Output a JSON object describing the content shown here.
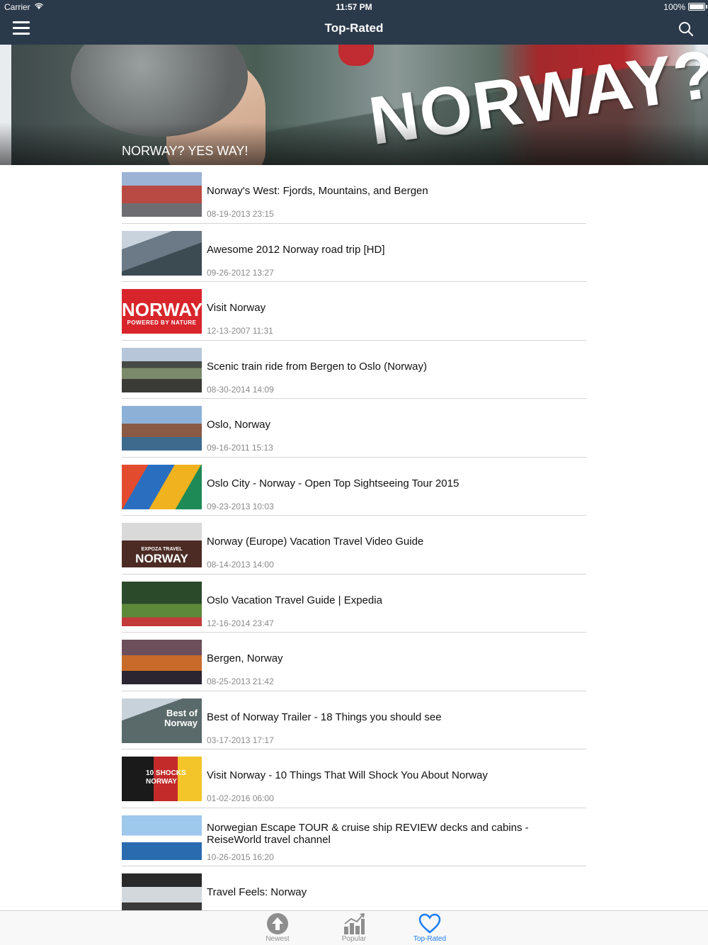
{
  "status_bar": {
    "carrier": "Carrier",
    "time": "11:57 PM",
    "battery": "100%"
  },
  "nav": {
    "title": "Top-Rated",
    "menu_icon": "hamburger-menu-icon",
    "search_icon": "search-icon"
  },
  "hero": {
    "caption": "NORWAY? YES WAY!",
    "image_text": "NORWAY?"
  },
  "videos": [
    {
      "title": "Norway's West: Fjords, Mountains, and Bergen",
      "date": "08-19-2013 23:15"
    },
    {
      "title": "Awesome 2012 Norway road trip [HD]",
      "date": "09-26-2012 13:27"
    },
    {
      "title": "Visit Norway",
      "date": "12-13-2007 11:31",
      "thumb_text": "NORWAY",
      "thumb_subtext": "POWERED BY NATURE"
    },
    {
      "title": "Scenic train ride from Bergen to Oslo (Norway)",
      "date": "08-30-2014 14:09"
    },
    {
      "title": "Oslo, Norway",
      "date": "09-16-2011 15:13"
    },
    {
      "title": "Oslo City - Norway - Open Top Sightseeing Tour 2015",
      "date": "09-23-2013 10:03"
    },
    {
      "title": "Norway (Europe) Vacation Travel Video Guide",
      "date": "08-14-2013 14:00",
      "thumb_text": "EXPOZA TRAVEL",
      "thumb_subtext": "NORWAY"
    },
    {
      "title": "Oslo Vacation Travel Guide | Expedia",
      "date": "12-16-2014 23:47"
    },
    {
      "title": "Bergen, Norway",
      "date": "08-25-2013 21:42"
    },
    {
      "title": "Best of Norway Trailer - 18 Things you should see",
      "date": "03-17-2013 17:17",
      "thumb_text": "Best of",
      "thumb_subtext": "Norway"
    },
    {
      "title": "Visit Norway - 10 Things That Will Shock You About Norway",
      "date": "01-02-2016 06:00",
      "thumb_text": "10 SHOCKS",
      "thumb_subtext": "NORWAY"
    },
    {
      "title": "Norwegian Escape TOUR & cruise ship REVIEW decks and cabins  - ReiseWorld travel channel",
      "date": "10-26-2015 16:20"
    },
    {
      "title": "Travel Feels: Norway",
      "date": ""
    }
  ],
  "tabs": [
    {
      "label": "Newest",
      "icon": "arrow-up-circle-icon"
    },
    {
      "label": "Popular",
      "icon": "bar-chart-icon"
    },
    {
      "label": "Top-Rated",
      "icon": "heart-icon"
    }
  ],
  "colors": {
    "nav_bg": "#2b3a4a",
    "accent": "#1a7cf5",
    "date_text": "#8a8a8a"
  }
}
